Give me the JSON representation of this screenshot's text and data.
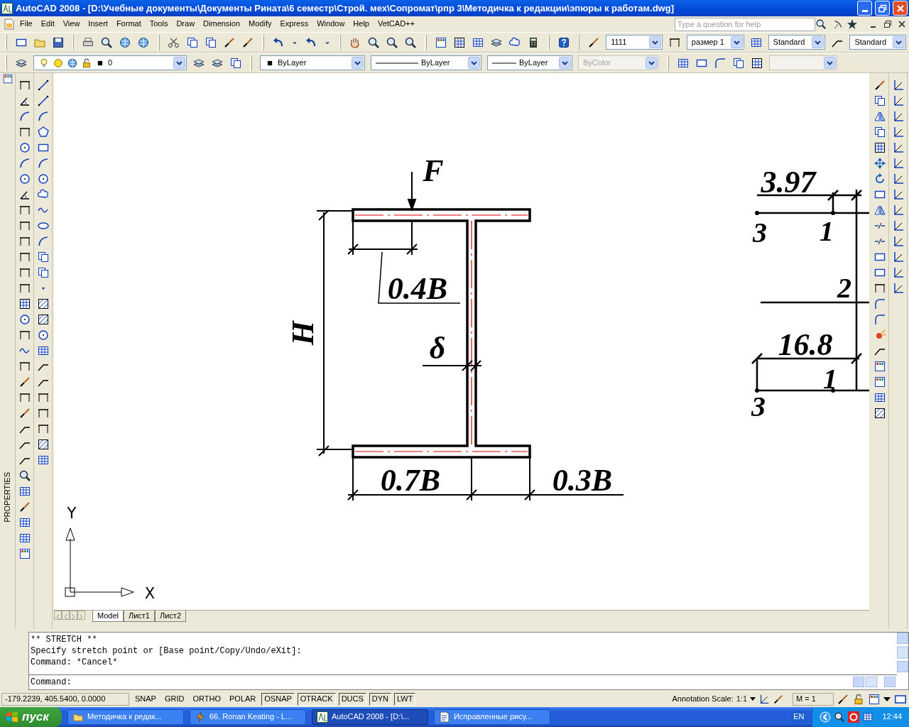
{
  "window": {
    "title": "AutoCAD 2008 - [D:\\Учебные документы\\Документы Рината\\6 семестр\\Строй. мех\\Сопромат\\рпр 3\\Методичка к редакции\\эпюры к работам.dwg]"
  },
  "menu": [
    "File",
    "Edit",
    "View",
    "Insert",
    "Format",
    "Tools",
    "Draw",
    "Dimension",
    "Modify",
    "Express",
    "Window",
    "Help",
    "VetCAD++"
  ],
  "help_search": {
    "placeholder": "Type a question for help"
  },
  "styles_toolbar": {
    "text_style": "1111",
    "dimension_style": "размер 1",
    "table_style": "Standard",
    "multileader_style": "Standard"
  },
  "layers_toolbar": {
    "layer": "0",
    "color_setting": "ByLayer",
    "linetype": "ByLayer",
    "lineweight": "ByLayer",
    "plot_style": {
      "value": "ByColor",
      "disabled": true
    }
  },
  "side_panel": {
    "label": "PROPERTIES"
  },
  "drawing": {
    "labels": [
      {
        "text": "F",
        "kind": "force"
      },
      {
        "text": "0.4B",
        "kind": "dimension"
      },
      {
        "text": "H",
        "kind": "dimension"
      },
      {
        "text": "δ",
        "kind": "dimension"
      },
      {
        "text": "0.7B",
        "kind": "dimension"
      },
      {
        "text": "0.3B",
        "kind": "dimension"
      },
      {
        "text": "3.97",
        "kind": "dimension"
      },
      {
        "text": "3",
        "kind": "node"
      },
      {
        "text": "1",
        "kind": "node"
      },
      {
        "text": "2",
        "kind": "node"
      },
      {
        "text": "16.8",
        "kind": "dimension"
      },
      {
        "text": "1",
        "kind": "node"
      },
      {
        "text": "3",
        "kind": "node"
      },
      {
        "text": "Y",
        "kind": "axis"
      },
      {
        "text": "X",
        "kind": "axis"
      }
    ]
  },
  "layout_tabs": [
    {
      "label": "Model",
      "selected": true
    },
    {
      "label": "Лист1",
      "selected": false
    },
    {
      "label": "Лист2",
      "selected": false
    }
  ],
  "command_window": {
    "history": [
      "** STRETCH **",
      "Specify stretch point or [Base point/Copy/Undo/eXit]:",
      "Command: *Cancel*"
    ],
    "prompt": "Command:"
  },
  "status_bar": {
    "coordinates": "-179.2239, 405.5400, 0.0000",
    "toggles": [
      {
        "label": "SNAP",
        "on": false
      },
      {
        "label": "GRID",
        "on": false
      },
      {
        "label": "ORTHO",
        "on": false
      },
      {
        "label": "POLAR",
        "on": false
      },
      {
        "label": "OSNAP",
        "on": true
      },
      {
        "label": "OTRACK",
        "on": true
      },
      {
        "label": "DUCS",
        "on": true
      },
      {
        "label": "DYN",
        "on": true
      },
      {
        "label": "LWT",
        "on": true
      }
    ],
    "annotation_label": "Annotation Scale:",
    "annotation_scale": "1:1",
    "model_scale": "M = 1"
  },
  "taskbar": {
    "start": "пуск",
    "tasks": [
      {
        "label": "Методичка к редак...",
        "kind": "folder",
        "selected": false
      },
      {
        "label": "66. Ronan Keating - L...",
        "kind": "player",
        "selected": false
      },
      {
        "label": "AutoCAD 2008 - [D:\\...",
        "kind": "cad",
        "selected": true
      },
      {
        "label": "Исправленные рису...",
        "kind": "document",
        "selected": false
      }
    ],
    "language": "EN",
    "clock": "12:44"
  }
}
